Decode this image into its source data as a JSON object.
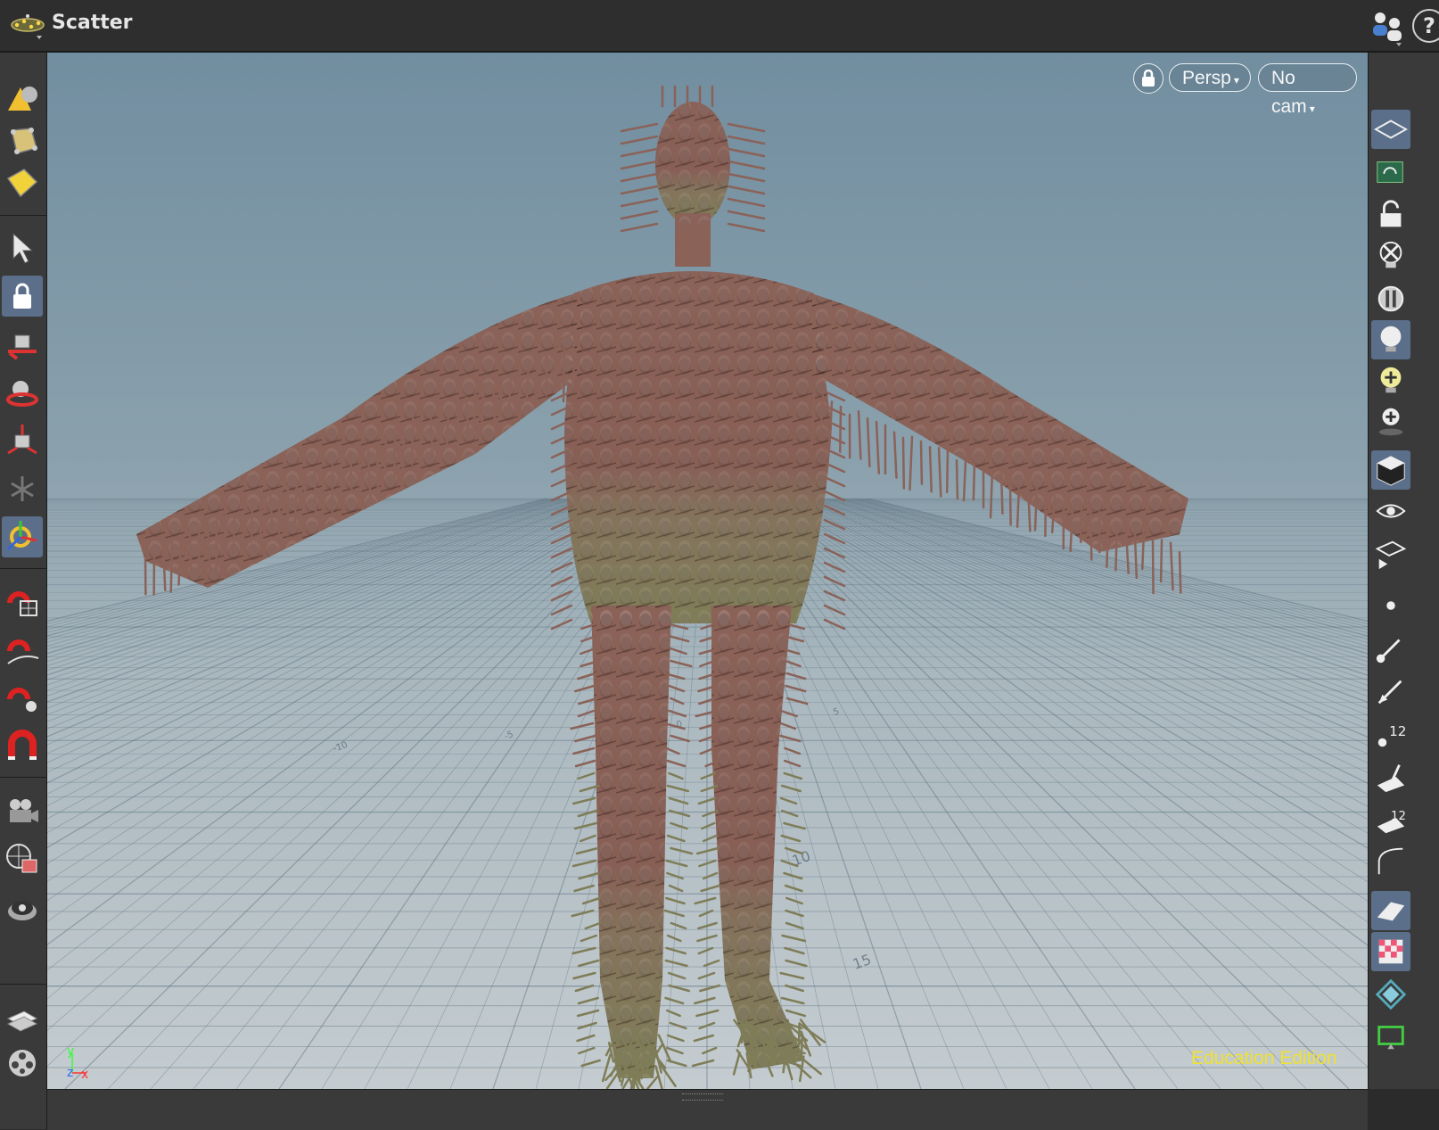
{
  "pane": {
    "title": "Scatter",
    "title_icon": "scatter-node-icon",
    "right_icons": [
      "users-icon",
      "help-icon"
    ],
    "help_label": "?"
  },
  "viewport": {
    "persp_label": "Persp",
    "cam_label": "No cam",
    "edition_label": "Education Edition",
    "lock_icon": "viewport-lock-icon",
    "axis_labels": {
      "x": "x",
      "y": "y",
      "z": "z"
    },
    "grid_labels": [
      "10",
      "15",
      "-10",
      "-5",
      "0",
      "5"
    ],
    "colors": {
      "sky_top": "#718ea0",
      "floor": "#c4ccd0",
      "body": "#8a6258",
      "legs": "#7f7d58",
      "edition_text": "#f0e130"
    }
  },
  "left_toolbar": [
    "create-geometry-icon",
    "scatter-points-icon",
    "box-select-icon",
    "select-arrow-icon",
    "lock-icon",
    "move-handle-icon",
    "rotate-handle-icon",
    "scale-handle-icon",
    "pose-icon",
    "transform-handle-icon",
    "snap-grid-icon",
    "snap-curve-icon",
    "snap-point-icon",
    "snap-magnet-icon",
    "camera-icon",
    "display-options-icon",
    "lens-icon",
    "layers-icon",
    "film-icon"
  ],
  "right_toolbar": [
    "wireframe-icon",
    "rotate-view-icon",
    "unlock-icon",
    "ghost-light-icon",
    "shading-icon",
    "light-bulb-icon",
    "add-light-icon",
    "spot-light-icon",
    "shaded-cube-icon",
    "eye-icon",
    "render-icon",
    "point-icon",
    "brush-icon",
    "pen-icon",
    "point-number-icon",
    "normal-icon",
    "numbered-plane-icon",
    "curve-icon",
    "surface-icon",
    "checker-icon",
    "diamond-icon",
    "frame-icon"
  ]
}
